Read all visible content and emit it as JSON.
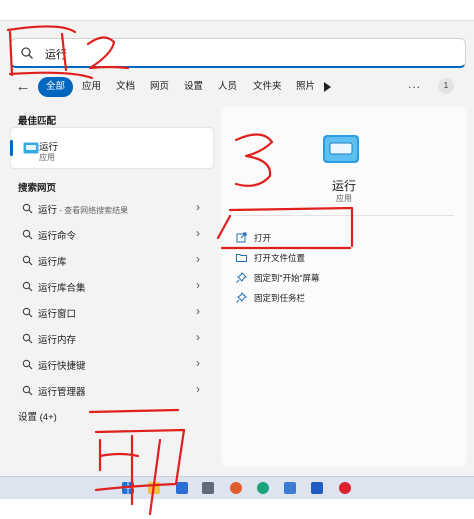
{
  "search": {
    "query": "运行",
    "icon": "search-icon"
  },
  "filters": {
    "back_icon": "back-arrow-icon",
    "chips": [
      "全部",
      "应用",
      "文档",
      "网页",
      "设置",
      "人员",
      "文件夹",
      "照片"
    ],
    "active": "全部",
    "more_icon": "play-icon",
    "overflow": "...",
    "badge": "1"
  },
  "best_match": {
    "heading": "最佳匹配",
    "name": "运行",
    "kind": "应用"
  },
  "web_search": {
    "heading": "搜索网页",
    "items": [
      {
        "label": "运行",
        "suffix": " - 查看网络搜索结果"
      },
      {
        "label": "运行命令",
        "suffix": ""
      },
      {
        "label": "运行库",
        "suffix": ""
      },
      {
        "label": "运行库合集",
        "suffix": ""
      },
      {
        "label": "运行窗口",
        "suffix": ""
      },
      {
        "label": "运行内存",
        "suffix": ""
      },
      {
        "label": "运行快捷键",
        "suffix": ""
      },
      {
        "label": "运行管理器",
        "suffix": ""
      }
    ]
  },
  "settings": {
    "label": "设置 (4+)"
  },
  "detail": {
    "name": "运行",
    "kind": "应用",
    "actions": [
      {
        "label": "打开",
        "icon": "open-external-icon"
      },
      {
        "label": "打开文件位置",
        "icon": "folder-icon"
      },
      {
        "label": "固定到\"开始\"屏幕",
        "icon": "pin-icon"
      },
      {
        "label": "固定到任务栏",
        "icon": "pin-icon"
      }
    ]
  },
  "annotations": [
    "1",
    "2",
    "3",
    "4"
  ],
  "colors": {
    "accent": "#0067c0",
    "annotation": "#e0201c",
    "panel": "#f3f3f3"
  },
  "taskbar": {
    "icons": [
      "windows-start-icon",
      "file-explorer-icon",
      "terminal-icon",
      "notepad-icon",
      "firefox-icon",
      "edge-icon",
      "app-icon",
      "word-icon",
      "netease-music-icon"
    ]
  }
}
